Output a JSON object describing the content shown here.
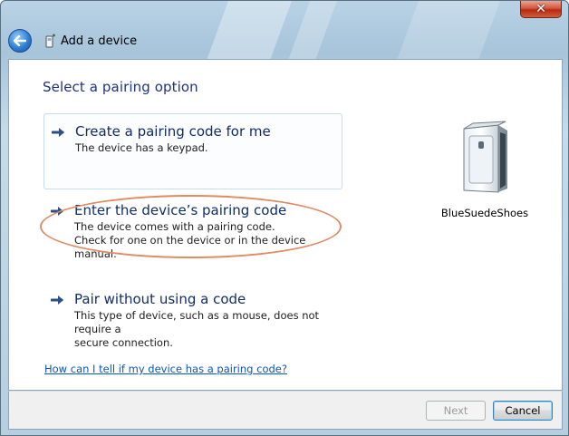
{
  "window": {
    "title": "Add a device",
    "close_glyph": "✕"
  },
  "main": {
    "heading": "Select a pairing option",
    "options": [
      {
        "title": "Create a pairing code for me",
        "desc_lines": [
          "The device has a keypad."
        ]
      },
      {
        "title": "Enter the device’s pairing code",
        "desc_lines": [
          "The device comes with a pairing code.",
          "Check for one on the device or in the device manual."
        ]
      },
      {
        "title": "Pair without using a code",
        "desc_lines": [
          "This type of device, such as a mouse, does not require a",
          "secure connection."
        ]
      }
    ],
    "help_link": "How can I tell if my device has a pairing code?"
  },
  "device": {
    "name": "BlueSuedeShoes",
    "icon": "device-tower-icon"
  },
  "buttons": {
    "next": "Next",
    "cancel": "Cancel"
  },
  "colors": {
    "heading": "#1e3287",
    "option_title": "#102d6b",
    "link": "#0b55c4",
    "annotation": "#e08b62"
  }
}
